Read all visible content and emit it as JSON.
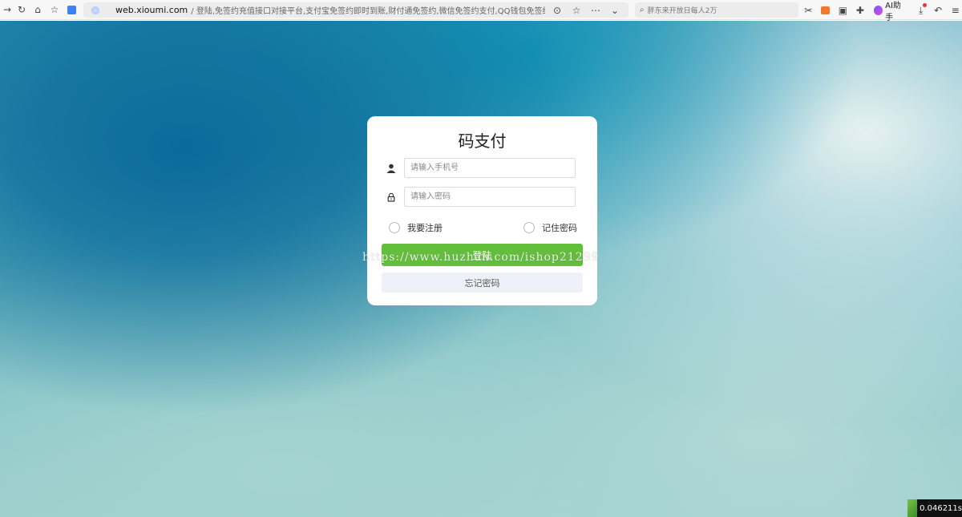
{
  "browser": {
    "address_domain": "web.xioumi.com",
    "address_rest": "/ 登陆,免签约充值接口对接平台,支付宝免签约即时到账,财付通免签约,微信免签约支付,QQ钱包免签约,免签约支付,免签约",
    "search_placeholder": "胖东来开放日每人2万",
    "ai_label": "AI助手"
  },
  "login": {
    "title": "码支付",
    "phone_placeholder": "请输入手机号",
    "password_placeholder": "请输入密码",
    "register_label": "我要注册",
    "remember_label": "记住密码",
    "login_button": "登陆",
    "forgot_button": "忘记密码"
  },
  "watermark": "https://www.huzhan.com/ishop21299",
  "timer": "0.046211s",
  "colors": {
    "login_button": "#63bf3b",
    "forgot_button": "#eef2f8"
  }
}
